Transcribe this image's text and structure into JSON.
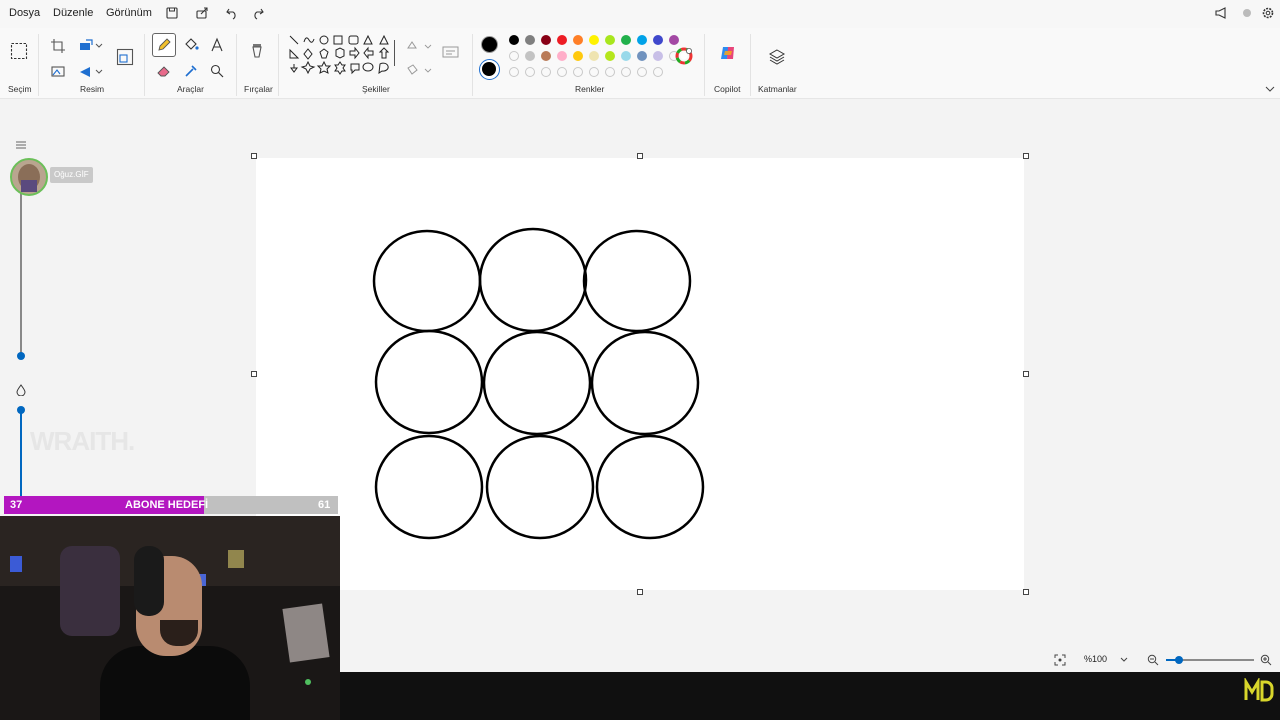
{
  "menu": {
    "file": "Dosya",
    "edit": "Düzenle",
    "view": "Görünüm"
  },
  "ribbon": {
    "selection": "Seçim",
    "image": "Resim",
    "tools": "Araçlar",
    "brushes": "Fırçalar",
    "shapes": "Şekiller",
    "colors": "Renkler",
    "copilot": "Copilot",
    "layers": "Katmanlar"
  },
  "palette": {
    "primary": "#000000",
    "secondary": "#000000",
    "row1": [
      "#000000",
      "#7f7f7f",
      "#880015",
      "#ed1c24",
      "#ff7f27",
      "#fff200",
      "#a8e61d",
      "#22b14c",
      "#00a2e8",
      "#3f48cc",
      "#a349a4"
    ],
    "row2": [
      "",
      "#c3c3c3",
      "#b97a57",
      "#ffaec9",
      "#ffc90e",
      "#efe4b0",
      "#b5e61d",
      "#99d9ea",
      "#7092be",
      "#c8bfe7",
      ""
    ],
    "row3_count": 10
  },
  "layers_panel": {
    "layer_name": "Oğuz.GİF"
  },
  "status": {
    "zoom": "%100"
  },
  "overlay": {
    "goal_title": "ABONE HEDEFİ",
    "goal_current": "37",
    "goal_target": "61",
    "goal_fraction": 0.6,
    "watermark": "WRAITH."
  },
  "colors": {
    "accent": "#0067c0",
    "goal_fill": "#b316c0",
    "layer_ring": "#6bbf59"
  }
}
